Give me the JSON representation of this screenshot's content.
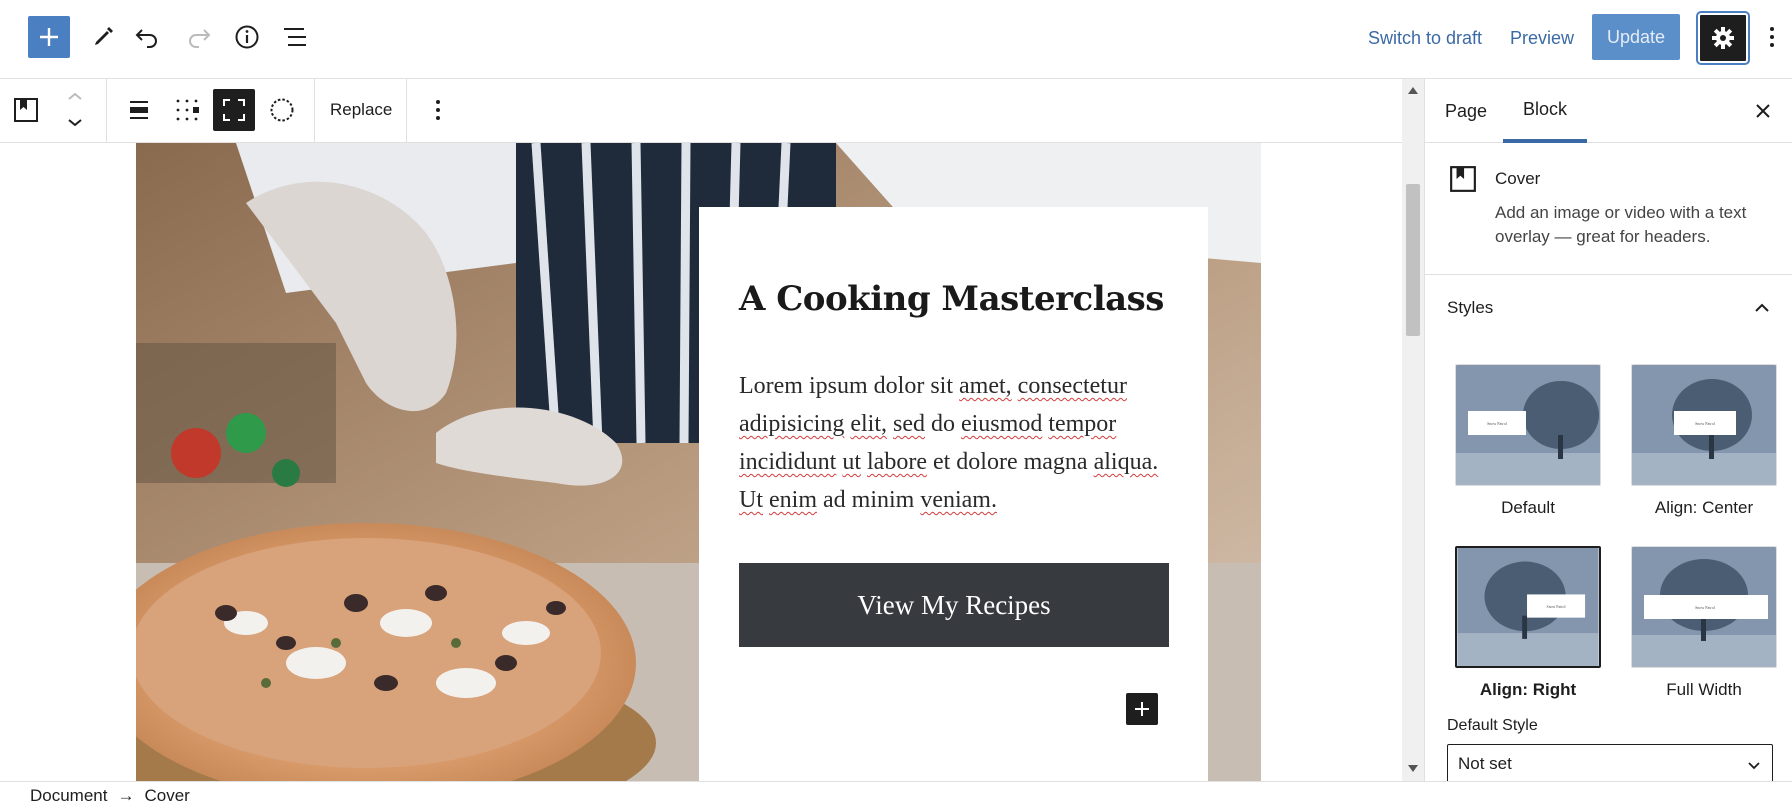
{
  "topbar": {
    "add_label": "+",
    "switch_to_draft": "Switch to draft",
    "preview": "Preview",
    "update": "Update"
  },
  "toolbar": {
    "replace": "Replace"
  },
  "cover": {
    "title": "A Cooking Masterclass",
    "text_words": [
      "Lorem",
      "ipsum",
      "dolor",
      "sit",
      "amet,",
      "consectetur",
      "adipisicing",
      "elit,",
      "sed",
      "do",
      "eiusmod",
      "tempor",
      "incididunt",
      "ut",
      "labore",
      "et",
      "dolore",
      "magna",
      "aliqua.",
      "Ut",
      "enim",
      "ad",
      "minim",
      "veniam."
    ],
    "button": "View My Recipes"
  },
  "sidebar": {
    "tabs": [
      "Page",
      "Block"
    ],
    "active_tab": "Block",
    "block_name": "Cover",
    "block_description": "Add an image or video with a text overlay — great for headers.",
    "styles_title": "Styles",
    "styles": [
      {
        "label": "Default",
        "selected": false
      },
      {
        "label": "Align: Center",
        "selected": false
      },
      {
        "label": "Align: Right",
        "selected": true
      },
      {
        "label": "Full Width",
        "selected": false
      }
    ],
    "thumb_text": "Snow Patrol",
    "default_style_label": "Default Style",
    "default_style_value": "Not set"
  },
  "breadcrumb": [
    "Document",
    "Cover"
  ],
  "breadcrumb_separator": "→",
  "colors": {
    "accent": "#4a7fc1",
    "dark": "#1e1e1e",
    "button_bg": "#373a3f"
  }
}
